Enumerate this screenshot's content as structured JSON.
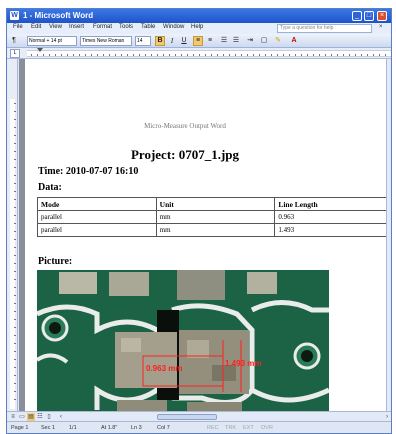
{
  "window": {
    "title": "1 - Microsoft Word",
    "app_icon": "word-icon",
    "controls": [
      "_",
      "□",
      "×"
    ]
  },
  "menu": {
    "items": [
      "File",
      "Edit",
      "View",
      "Insert",
      "Format",
      "Tools",
      "Table",
      "Window",
      "Help"
    ],
    "help_placeholder": "Type a question for help",
    "close_glyph": "×"
  },
  "toolbar": {
    "style": "Normal + 14 pt",
    "font": "Times New Roman",
    "size": "14",
    "bold": "B",
    "italic": "I",
    "underline": "U"
  },
  "document": {
    "header": "Micro-Measure Output Word",
    "project_title": "Project: 0707_1.jpg",
    "time": "Time: 2010-07-07  16:10",
    "data_label": "Data:",
    "table": {
      "headers": [
        "Mode",
        "Unit",
        "Line Length"
      ],
      "rows": [
        [
          "parallel",
          "mm",
          "0.963"
        ],
        [
          "parallel",
          "mm",
          "1.493"
        ]
      ]
    },
    "picture_label": "Picture:",
    "photo_annotations": [
      "0.963 mm",
      "1.493 mm"
    ],
    "annotation_color": "#ff2020"
  },
  "status": {
    "page": "Page 1",
    "section": "Sec 1",
    "pages": "1/1",
    "at": "At 1.8\"",
    "line": "Ln 3",
    "col": "Col 7",
    "modes": [
      "REC",
      "TRK",
      "EXT",
      "OVR"
    ]
  },
  "colors": {
    "title_bar": "#1f53c9",
    "accent": "#3a78e6",
    "pcb_green": "#1f6b4a"
  }
}
